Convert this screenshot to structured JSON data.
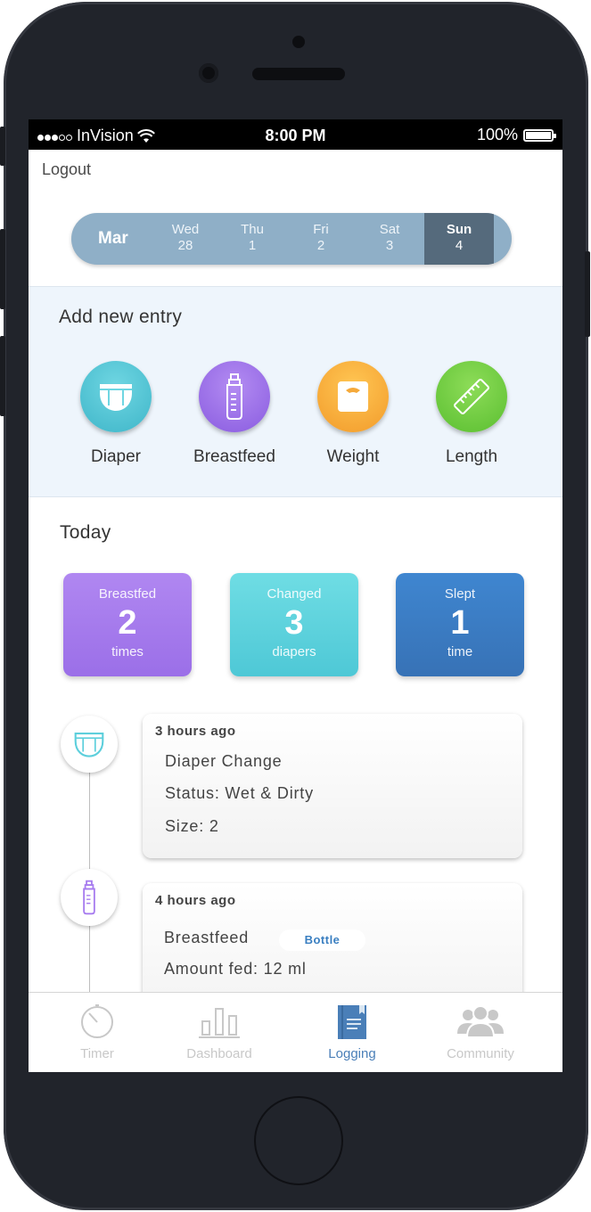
{
  "status_bar": {
    "carrier": "InVision",
    "time": "8:00 PM",
    "battery": "100%"
  },
  "header": {
    "logout_label": "Logout"
  },
  "date_bar": {
    "month": "Mar",
    "days": [
      {
        "name": "Wed",
        "num": "28"
      },
      {
        "name": "Thu",
        "num": "1"
      },
      {
        "name": "Fri",
        "num": "2"
      },
      {
        "name": "Sat",
        "num": "3"
      },
      {
        "name": "Sun",
        "num": "4"
      }
    ],
    "selected": "Sun"
  },
  "add_entry": {
    "title": "Add new entry",
    "items": [
      {
        "label": "Diaper",
        "icon": "diaper-icon",
        "color": "#4fc3d4"
      },
      {
        "label": "Breastfeed",
        "icon": "bottle-icon",
        "color": "#9b6ee6"
      },
      {
        "label": "Weight",
        "icon": "scale-icon",
        "color": "#f5a93a"
      },
      {
        "label": "Length",
        "icon": "tape-measure-icon",
        "color": "#6ccb3f"
      }
    ]
  },
  "today": {
    "title": "Today",
    "stats": [
      {
        "top": "Breastfed",
        "value": "2",
        "bottom": "times",
        "color": "#a77cef"
      },
      {
        "top": "Changed",
        "value": "3",
        "bottom": "diapers",
        "color": "#5dd3dc"
      },
      {
        "top": "Slept",
        "value": "1",
        "bottom": "time",
        "color": "#3a7bc4"
      }
    ]
  },
  "log": [
    {
      "ago": "3 hours ago",
      "lines": [
        "Diaper Change",
        "Status: Wet & Dirty",
        "Size: 2"
      ],
      "icon": "diaper-icon"
    },
    {
      "ago": "4 hours ago",
      "lines": [
        "Breastfeed",
        "Amount fed: 12 ml"
      ],
      "badge": "Bottle",
      "icon": "bottle-icon"
    }
  ],
  "tabs": [
    {
      "label": "Timer",
      "icon": "timer-icon"
    },
    {
      "label": "Dashboard",
      "icon": "bar-chart-icon"
    },
    {
      "label": "Logging",
      "icon": "notebook-icon",
      "active": true
    },
    {
      "label": "Community",
      "icon": "people-icon"
    }
  ]
}
